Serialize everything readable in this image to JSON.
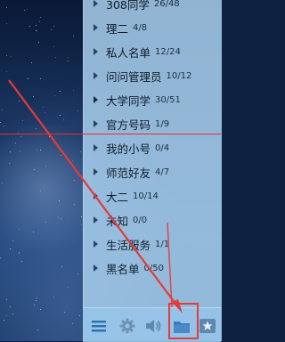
{
  "groups": [
    {
      "name": "308同学",
      "count": "26/48",
      "arrow": "normal"
    },
    {
      "name": "理二",
      "count": "4/8",
      "arrow": "normal"
    },
    {
      "name": "私人名单",
      "count": "12/24",
      "arrow": "normal"
    },
    {
      "name": "问问管理员",
      "count": "10/12",
      "arrow": "normal"
    },
    {
      "name": "大学同学",
      "count": "30/51",
      "arrow": "dark"
    },
    {
      "name": "官方号码",
      "count": "1/9",
      "arrow": "normal"
    },
    {
      "name": "我的小号",
      "count": "0/4",
      "arrow": "normal"
    },
    {
      "name": "师范好友",
      "count": "4/7",
      "arrow": "normal"
    },
    {
      "name": "大二",
      "count": "10/14",
      "arrow": "normal"
    },
    {
      "name": "未知",
      "count": "0/0",
      "arrow": "normal"
    },
    {
      "name": "生活服务",
      "count": "1/1",
      "arrow": "normal"
    },
    {
      "name": "黑名单",
      "count": "0/50",
      "arrow": "normal"
    }
  ],
  "toolbar": [
    {
      "icon": "menu-icon"
    },
    {
      "icon": "gear-icon"
    },
    {
      "icon": "speaker-icon"
    },
    {
      "icon": "folder-icon"
    },
    {
      "icon": "star-icon"
    }
  ],
  "colors": {
    "annotation": "#e53a3a",
    "panel": "#a8ceec",
    "toolbar_icon": "#2f6fb0"
  }
}
